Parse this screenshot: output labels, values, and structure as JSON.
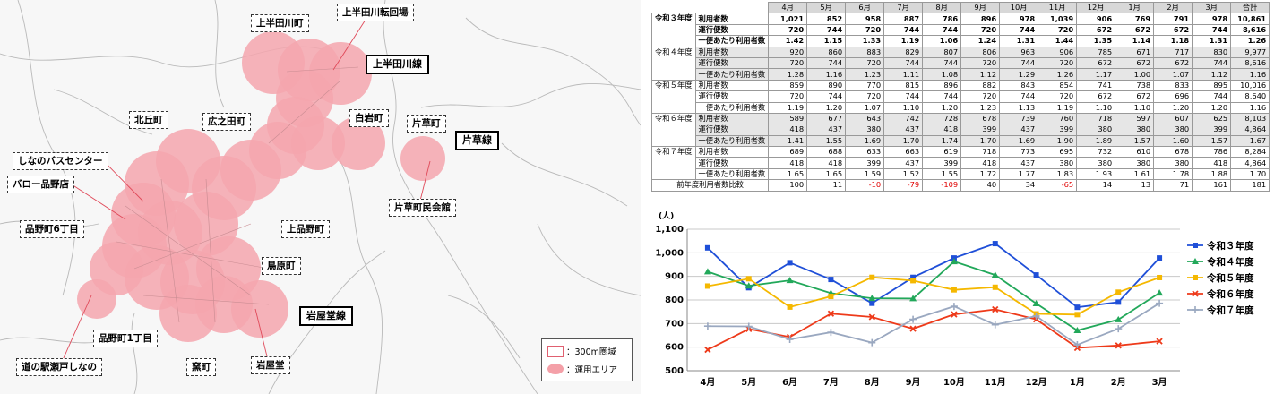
{
  "map": {
    "places": [
      {
        "key": "kamihandagawa_turn",
        "label": "上半田川転回場"
      },
      {
        "key": "kamihandagawa_town",
        "label": "上半田川町"
      },
      {
        "key": "kitaoka",
        "label": "北丘町"
      },
      {
        "key": "hironoda",
        "label": "広之田町"
      },
      {
        "key": "shiraiwa",
        "label": "白岩町"
      },
      {
        "key": "katakusa",
        "label": "片草町"
      },
      {
        "key": "bus_center",
        "label": "しなのバスセンター"
      },
      {
        "key": "valor",
        "label": "バロー品野店"
      },
      {
        "key": "shinano6",
        "label": "品野町6丁目"
      },
      {
        "key": "kamishinano",
        "label": "上品野町"
      },
      {
        "key": "toribara",
        "label": "鳥原町"
      },
      {
        "key": "katakusa_hall",
        "label": "片草町民会館"
      },
      {
        "key": "shinano1",
        "label": "品野町1丁目"
      },
      {
        "key": "michinoeki",
        "label": "道の駅瀬戸しなの"
      },
      {
        "key": "kama",
        "label": "窯町"
      },
      {
        "key": "iwayado",
        "label": "岩屋堂"
      }
    ],
    "routes": [
      {
        "key": "kamihandagawa_line",
        "label": "上半田川線"
      },
      {
        "key": "katakusa_line",
        "label": "片草線"
      },
      {
        "key": "iwayado_line",
        "label": "岩屋堂線"
      }
    ],
    "legend": {
      "circle_label": "：300m圏域",
      "area_label": "：運用エリア"
    }
  },
  "table": {
    "months": [
      "4月",
      "5月",
      "6月",
      "7月",
      "8月",
      "9月",
      "10月",
      "11月",
      "12月",
      "1月",
      "2月",
      "3月"
    ],
    "total_label": "合計",
    "years": [
      {
        "year": "令和３年度",
        "highlight": true,
        "rows": [
          {
            "label": "利用者数",
            "values": [
              "1,021",
              "852",
              "958",
              "887",
              "786",
              "896",
              "978",
              "1,039",
              "906",
              "769",
              "791",
              "978"
            ],
            "total": "10,861"
          },
          {
            "label": "運行便数",
            "values": [
              "720",
              "744",
              "720",
              "744",
              "744",
              "720",
              "744",
              "720",
              "672",
              "672",
              "672",
              "744"
            ],
            "total": "8,616"
          },
          {
            "label": "一便あたり利用者数",
            "values": [
              "1.42",
              "1.15",
              "1.33",
              "1.19",
              "1.06",
              "1.24",
              "1.31",
              "1.44",
              "1.35",
              "1.14",
              "1.18",
              "1.31"
            ],
            "total": "1.26"
          }
        ]
      },
      {
        "year": "令和４年度",
        "highlight": false,
        "rows": [
          {
            "label": "利用者数",
            "values": [
              "920",
              "860",
              "883",
              "829",
              "807",
              "806",
              "963",
              "906",
              "785",
              "671",
              "717",
              "830"
            ],
            "total": "9,977"
          },
          {
            "label": "運行便数",
            "values": [
              "720",
              "744",
              "720",
              "744",
              "744",
              "720",
              "744",
              "720",
              "672",
              "672",
              "672",
              "744"
            ],
            "total": "8,616"
          },
          {
            "label": "一便あたり利用者数",
            "values": [
              "1.28",
              "1.16",
              "1.23",
              "1.11",
              "1.08",
              "1.12",
              "1.29",
              "1.26",
              "1.17",
              "1.00",
              "1.07",
              "1.12"
            ],
            "total": "1.16"
          }
        ]
      },
      {
        "year": "令和５年度",
        "highlight": false,
        "rows": [
          {
            "label": "利用者数",
            "values": [
              "859",
              "890",
              "770",
              "815",
              "896",
              "882",
              "843",
              "854",
              "741",
              "738",
              "833",
              "895"
            ],
            "total": "10,016"
          },
          {
            "label": "運行便数",
            "values": [
              "720",
              "744",
              "720",
              "744",
              "744",
              "720",
              "744",
              "720",
              "672",
              "672",
              "696",
              "744"
            ],
            "total": "8,640"
          },
          {
            "label": "一便あたり利用者数",
            "values": [
              "1.19",
              "1.20",
              "1.07",
              "1.10",
              "1.20",
              "1.23",
              "1.13",
              "1.19",
              "1.10",
              "1.10",
              "1.20",
              "1.20"
            ],
            "total": "1.16"
          }
        ]
      },
      {
        "year": "令和６年度",
        "highlight": false,
        "rows": [
          {
            "label": "利用者数",
            "values": [
              "589",
              "677",
              "643",
              "742",
              "728",
              "678",
              "739",
              "760",
              "718",
              "597",
              "607",
              "625"
            ],
            "total": "8,103"
          },
          {
            "label": "運行便数",
            "values": [
              "418",
              "437",
              "380",
              "437",
              "418",
              "399",
              "437",
              "399",
              "380",
              "380",
              "380",
              "399"
            ],
            "total": "4,864"
          },
          {
            "label": "一便あたり利用者数",
            "values": [
              "1.41",
              "1.55",
              "1.69",
              "1.70",
              "1.74",
              "1.70",
              "1.69",
              "1.90",
              "1.89",
              "1.57",
              "1.60",
              "1.57"
            ],
            "total": "1.67"
          }
        ]
      },
      {
        "year": "令和７年度",
        "highlight": false,
        "rows": [
          {
            "label": "利用者数",
            "values": [
              "689",
              "688",
              "633",
              "663",
              "619",
              "718",
              "773",
              "695",
              "732",
              "610",
              "678",
              "786"
            ],
            "total": "8,284"
          },
          {
            "label": "運行便数",
            "values": [
              "418",
              "418",
              "399",
              "437",
              "399",
              "418",
              "437",
              "380",
              "380",
              "380",
              "380",
              "418"
            ],
            "total": "4,864"
          },
          {
            "label": "一便あたり利用者数",
            "values": [
              "1.65",
              "1.65",
              "1.59",
              "1.52",
              "1.55",
              "1.72",
              "1.77",
              "1.83",
              "1.93",
              "1.61",
              "1.78",
              "1.88"
            ],
            "total": "1.70"
          }
        ]
      }
    ],
    "comparison": {
      "label": "前年度利用者数比較",
      "values": [
        "100",
        "11",
        "-10",
        "-79",
        "-109",
        "40",
        "34",
        "-65",
        "14",
        "13",
        "71",
        "161"
      ],
      "total": "181"
    }
  },
  "chart_data": {
    "type": "line",
    "categories": [
      "4月",
      "5月",
      "6月",
      "7月",
      "8月",
      "9月",
      "10月",
      "11月",
      "12月",
      "1月",
      "2月",
      "3月"
    ],
    "ylabel": "(人)",
    "ylim": [
      500,
      1100
    ],
    "yticks": [
      500,
      600,
      700,
      800,
      900,
      1000,
      1100
    ],
    "ytick_labels": [
      "500",
      "600",
      "700",
      "800",
      "900",
      "1,000",
      "1,100"
    ],
    "grid": true,
    "legend": "right",
    "series": [
      {
        "name": "令和３年度",
        "color": "#1f4fd8",
        "marker": "square",
        "values": [
          1021,
          852,
          958,
          887,
          786,
          896,
          978,
          1039,
          906,
          769,
          791,
          978
        ]
      },
      {
        "name": "令和４年度",
        "color": "#22a85a",
        "marker": "triangle",
        "values": [
          920,
          860,
          883,
          829,
          807,
          806,
          963,
          906,
          785,
          671,
          717,
          830
        ]
      },
      {
        "name": "令和５年度",
        "color": "#f5b800",
        "marker": "square",
        "values": [
          859,
          890,
          770,
          815,
          896,
          882,
          843,
          854,
          741,
          738,
          833,
          895
        ]
      },
      {
        "name": "令和６年度",
        "color": "#ee3a1a",
        "marker": "x",
        "values": [
          589,
          677,
          643,
          742,
          728,
          678,
          739,
          760,
          718,
          597,
          607,
          625
        ]
      },
      {
        "name": "令和７年度",
        "color": "#9aa8c0",
        "marker": "plus",
        "values": [
          689,
          688,
          633,
          663,
          619,
          718,
          773,
          695,
          732,
          610,
          678,
          786
        ]
      }
    ]
  }
}
